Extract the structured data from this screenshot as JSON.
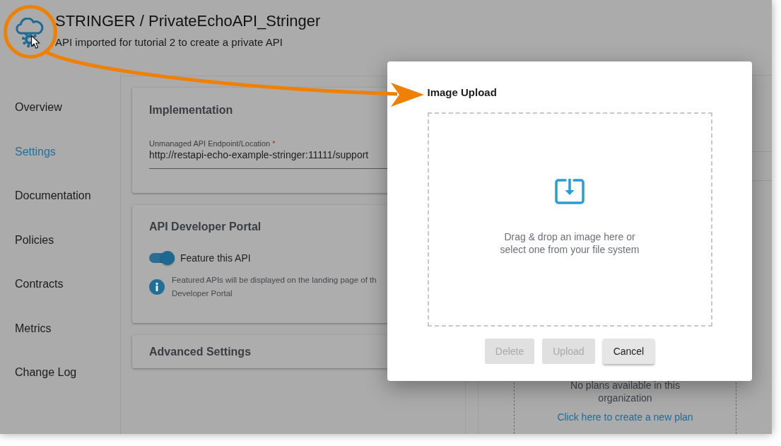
{
  "header": {
    "title": "STRINGER / PrivateEchoAPI_Stringer",
    "subtitle": "API imported for tutorial 2 to create a private API"
  },
  "sidebar": {
    "items": [
      {
        "label": "Overview",
        "selected": false
      },
      {
        "label": "Settings",
        "selected": true
      },
      {
        "label": "Documentation",
        "selected": false
      },
      {
        "label": "Policies",
        "selected": false
      },
      {
        "label": "Contracts",
        "selected": false
      },
      {
        "label": "Metrics",
        "selected": false
      },
      {
        "label": "Change Log",
        "selected": false
      }
    ]
  },
  "cards": [
    {
      "kind": "field",
      "title": "Implementation",
      "field": {
        "label": "Unmanaged API Endpoint/Location",
        "required_mark": "*",
        "value": "http://restapi-echo-example-stringer:11111/support"
      }
    },
    {
      "kind": "toggle",
      "title": "API Developer Portal",
      "toggle": {
        "label": "Feature this API",
        "on": true
      },
      "info_lines": [
        "Featured APIs will be displayed on the landing page of th",
        "Developer Portal"
      ]
    },
    {
      "kind": "plain",
      "title": "Advanced Settings"
    }
  ],
  "plans_panel": {
    "message": "No plans available in this organization",
    "link": "Click here to create a new plan"
  },
  "dialog": {
    "title": "Image Upload",
    "drop_zone": {
      "text": "Drag & drop an image here or select one from your file system"
    },
    "buttons": [
      {
        "label": "Delete",
        "disabled": true
      },
      {
        "label": "Upload",
        "disabled": true
      },
      {
        "label": "Cancel",
        "disabled": false
      }
    ]
  }
}
